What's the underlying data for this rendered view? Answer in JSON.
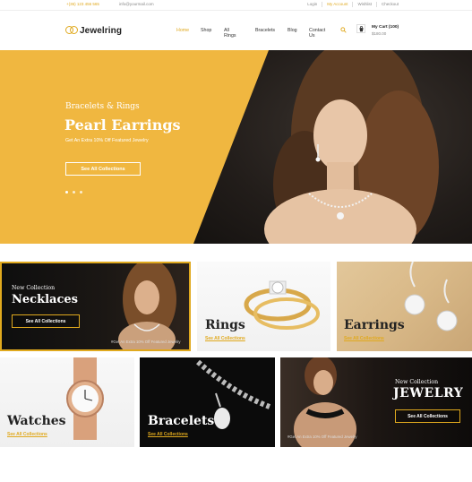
{
  "topbar": {
    "phone": "+(36) 123 456 565",
    "email": "info@yourmail.com",
    "links": [
      "Login",
      "My Account",
      "Wishlist",
      "Checkout"
    ]
  },
  "header": {
    "logo_text": "Jewelring",
    "nav": [
      "Home",
      "Shop",
      "All Rings",
      "Bracelets",
      "Blog",
      "Contact Us"
    ],
    "cart_title": "My Cart (100)",
    "cart_price": "$180.00"
  },
  "hero": {
    "subtitle": "Bracelets & Rings",
    "title": "Pearl Earrings",
    "description": "Get An Extra 10% Off Featured Jewelry",
    "button": "See All Collections",
    "slides": 3
  },
  "tiles": {
    "necklaces": {
      "kicker": "New Collection",
      "title": "Necklaces",
      "button": "See All Collections",
      "note": "#Get An Extra 10% Off Featured Jewelry"
    },
    "rings": {
      "title": "Rings",
      "link": "See All Collections"
    },
    "earrings": {
      "title": "Earrings",
      "link": "See All Collections"
    },
    "watches": {
      "title": "Watches",
      "link": "See All Collections"
    },
    "bracelets": {
      "title": "Bracelets",
      "link": "See All Collections"
    },
    "jewelry": {
      "kicker": "New Collection",
      "title": "JEWELRY",
      "button": "See All Collections",
      "note": "#Get An Extra 10% Off Featured Jewelry"
    }
  },
  "colors": {
    "accent": "#e0a91e",
    "hero_yellow": "#f0b740",
    "dark": "#1a1a1a"
  }
}
